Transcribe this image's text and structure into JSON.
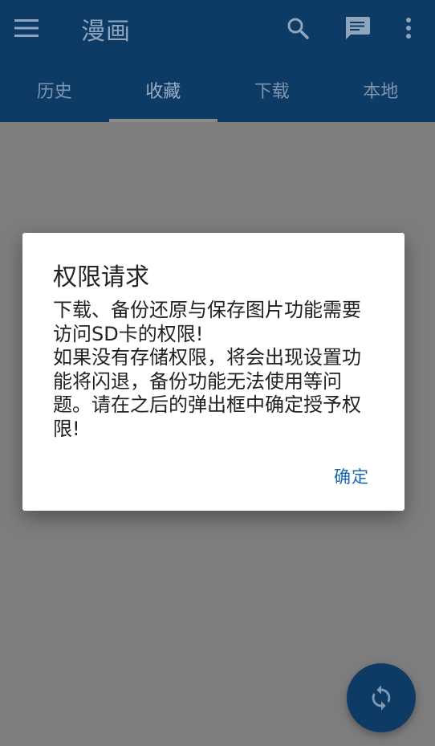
{
  "toolbar": {
    "title": "漫画",
    "menu_icon": "menu-icon",
    "search_icon": "search-icon",
    "chat_icon": "chat-icon",
    "more_icon": "more-vert-icon"
  },
  "tabs": [
    {
      "label": "历史",
      "active": false
    },
    {
      "label": "收藏",
      "active": true
    },
    {
      "label": "下载",
      "active": false
    },
    {
      "label": "本地",
      "active": false
    }
  ],
  "dialog": {
    "title": "权限请求",
    "message": "下载、备份还原与保存图片功能需要访问SD卡的权限!\n如果没有存储权限，将会出现设置功能将闪退，备份功能无法使用等问题。请在之后的弹出框中确定授予权限!",
    "confirm_label": "确定"
  },
  "fab": {
    "icon": "sync-icon"
  },
  "colors": {
    "primary": "#0e3b66",
    "scrim_background": "#7d7d7d",
    "accent_text": "#1b66b0"
  }
}
